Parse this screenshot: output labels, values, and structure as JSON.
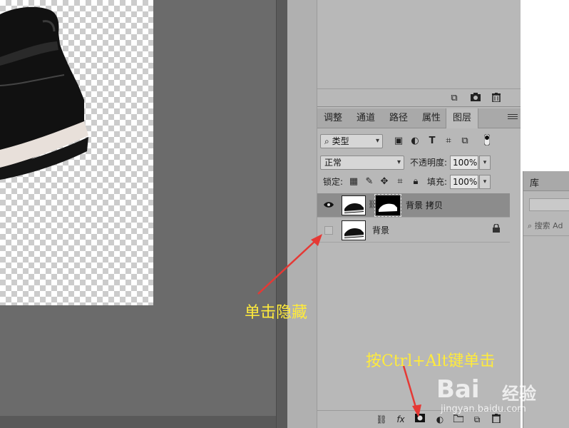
{
  "layers_panel": {
    "tabs": [
      {
        "label": "调整",
        "active": false
      },
      {
        "label": "通道",
        "active": false
      },
      {
        "label": "路径",
        "active": false
      },
      {
        "label": "属性",
        "active": false
      },
      {
        "label": "图层",
        "active": true
      }
    ],
    "filter": {
      "label": "类型"
    },
    "blend_mode": "正常",
    "opacity_label": "不透明度:",
    "opacity_value": "100%",
    "lock_label": "锁定:",
    "fill_label": "填充:",
    "fill_value": "100%",
    "layers": [
      {
        "name": "背景 拷贝",
        "visible": true,
        "selected": true,
        "has_mask": true,
        "locked": false
      },
      {
        "name": "背景",
        "visible": false,
        "selected": false,
        "has_mask": false,
        "locked": true
      }
    ],
    "bottom_icons": [
      "link-icon",
      "fx-icon",
      "add-mask-icon",
      "adjustment-icon",
      "group-folder-icon",
      "new-layer-icon",
      "trash-icon"
    ],
    "fx_label": "fx"
  },
  "top_panel": {
    "footer_icons": [
      "new-snapshot-icon",
      "camera-icon",
      "trash-icon"
    ]
  },
  "library_panel": {
    "tab_label": "库",
    "search_placeholder": "搜索 Ad"
  },
  "annotations": {
    "hide_click": "单击隐藏",
    "ctrl_alt_click": "按Ctrl+Alt键单击"
  },
  "watermark": {
    "logo": "Bai",
    "logo_cn": "经验",
    "url": "jingyan.baidu.com"
  },
  "colors": {
    "annotation": "#ffeb3b",
    "arrow": "#e53935",
    "panel_bg": "#b8b8b8",
    "canvas_bg": "#6b6b6b"
  }
}
